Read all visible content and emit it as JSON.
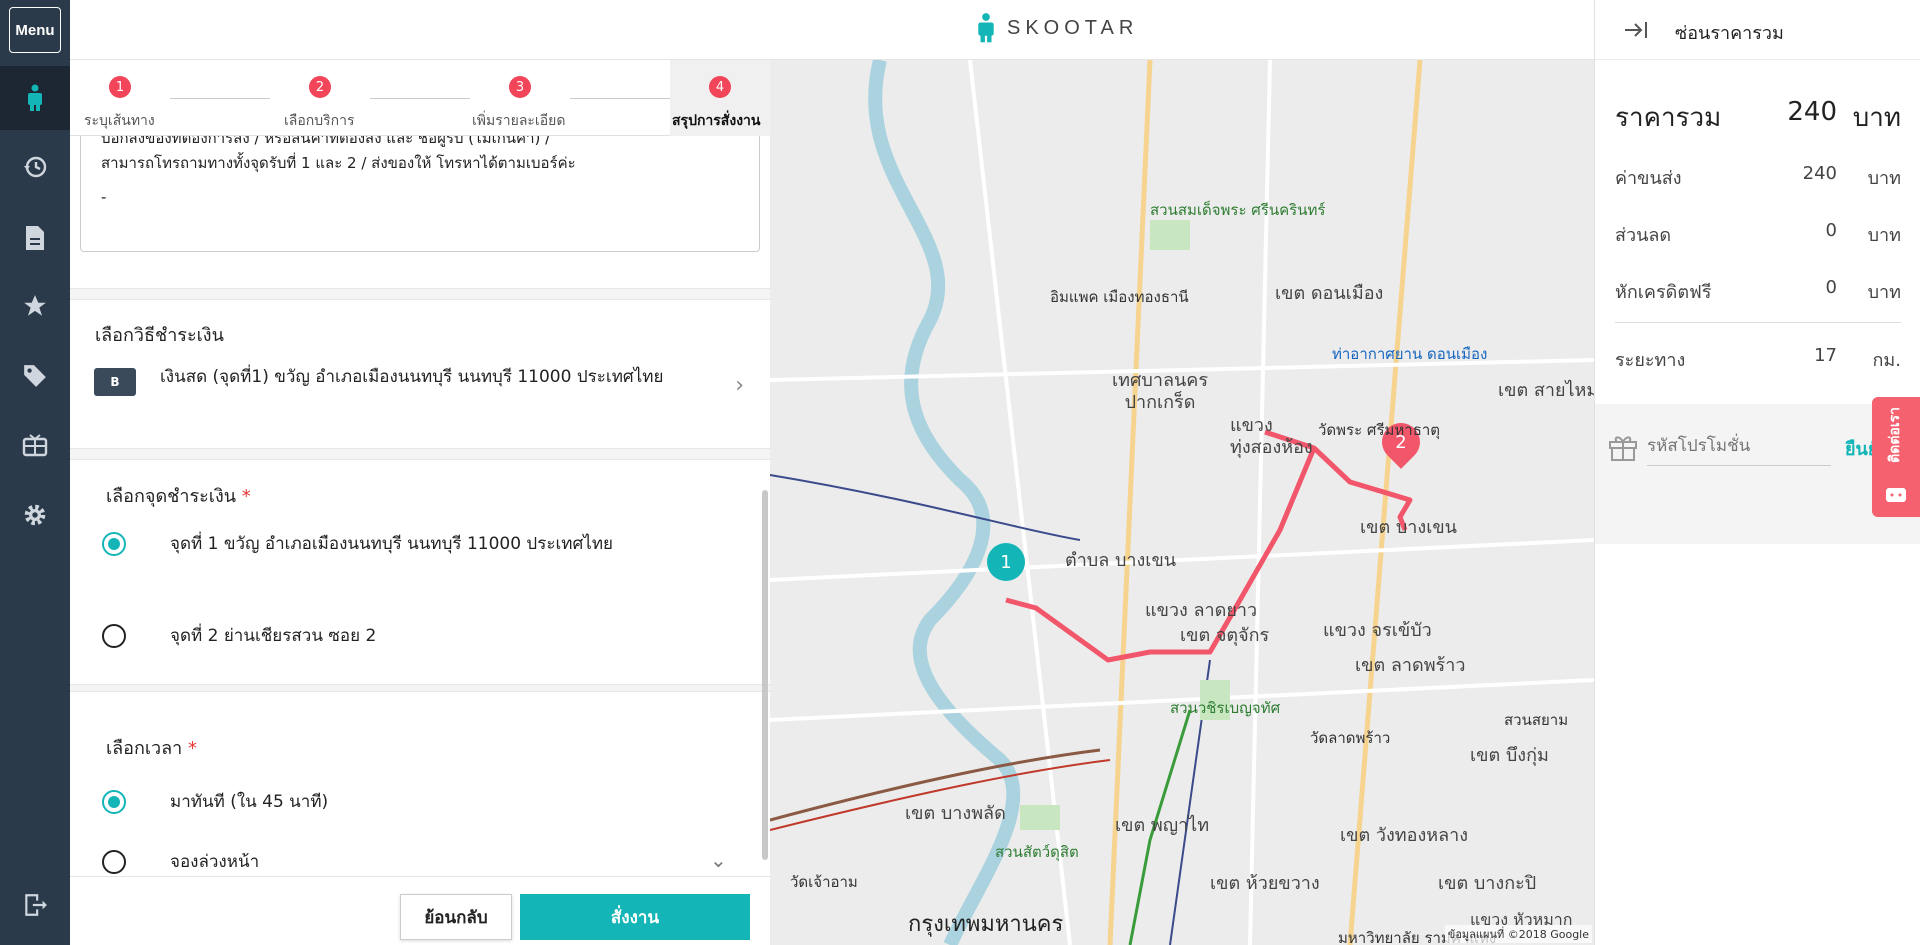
{
  "app": {
    "brand": "SKOOTAR"
  },
  "sidebar": {
    "menu_label": "Menu"
  },
  "steps": [
    {
      "num": "1",
      "label": "ระบุเส้นทาง"
    },
    {
      "num": "2",
      "label": "เลือกบริการ"
    },
    {
      "num": "3",
      "label": "เพิ่มรายละเอียด"
    },
    {
      "num": "4",
      "label": "สรุปการสั่งงาน"
    }
  ],
  "note": {
    "line1": "บอกสิ่งของที่ต้องการส่ง / หรือสินค้าที่ต้องส่ง และ ชื่อผู้รับ (ไม่เกินคำ) /",
    "line2": "สามารถโทรถามทางทั้งจุดรับที่ 1 และ 2 / ส่งของให้ โทรหาได้ตามเบอร์ค่ะ",
    "line3": "-"
  },
  "payment_method": {
    "title": "เลือกวิธีชำระเงิน",
    "icon_text": "B",
    "text": "เงินสด (จุดที่1) ขวัญ อำเภอเมืองนนทบุรี นนทบุรี 11000 ประเทศไทย"
  },
  "payment_point": {
    "title": "เลือกจุดชำระเงิน",
    "required_mark": "*",
    "options": [
      {
        "label": "จุดที่ 1 ขวัญ อำเภอเมืองนนทบุรี นนทบุรี 11000 ประเทศไทย",
        "selected": true
      },
      {
        "label": "จุดที่ 2 ย่านเชียรสวน ซอย 2",
        "selected": false
      }
    ]
  },
  "time": {
    "title": "เลือกเวลา",
    "required_mark": "*",
    "options": [
      {
        "label": "มาทันที (ใน 45 นาที)",
        "selected": true
      },
      {
        "label": "จองล่วงหน้า",
        "selected": false
      }
    ]
  },
  "footer": {
    "back_label": "ย้อนกลับ",
    "order_label": "สั่งงาน"
  },
  "map": {
    "labels": [
      "เขต ดอนเมือง",
      "เทศบาลนคร ปากเกร็ด",
      "แขวง ทุ่งสองห้อง",
      "เขต บางเขน",
      "ตำบล บางเขน",
      "แขวง ลาดยาว",
      "เขต จตุจักร",
      "แขวง จรเข้บัว",
      "เขต ลาดพร้าว",
      "เขต บางพลัด",
      "เขต พญาไท",
      "เขต วังทองหลาง",
      "เขต ห้วยขวาง",
      "เขต บางกะปิ",
      "กรุงเทพมหานคร",
      "เขต บึงกุ่ม",
      "เขต สายไหม",
      "แขวง หัวหมาก"
    ],
    "pois": [
      "สวนสมเด็จพระ ศรีนครินทร์",
      "อิมแพค เมืองทองธานี",
      "ท่าอากาศยาน ดอนเมือง",
      "วัดพระ ศรีมหาธาตุ",
      "สวนวชิรเบญจทัศ",
      "สวนสัตว์ดุสิต",
      "วัดลาดพร้าว",
      "วัดเจ้าอาม",
      "มหาวิทยาลัย รามคำแหง",
      "สวนสยาม"
    ],
    "markers": [
      "1",
      "2"
    ],
    "copyright": "ข้อมูลแผนที่ ©2018 Google",
    "route_color": "#f2566a"
  },
  "summary": {
    "header_label": "ซ่อนราคารวม",
    "total_label": "ราคารวม",
    "total_amount": "240",
    "currency": "บาท",
    "rows": [
      {
        "label": "ค่าขนส่ง",
        "amount": "240",
        "unit": "บาท"
      },
      {
        "label": "ส่วนลด",
        "amount": "0",
        "unit": "บาท"
      },
      {
        "label": "หักเครดิตฟรี",
        "amount": "0",
        "unit": "บาท"
      }
    ],
    "distance_label": "ระยะทาง",
    "distance_amount": "17",
    "distance_unit": "กม.",
    "promo_placeholder": "รหัสโปรโมชั่น",
    "promo_confirm": "ยืนยัน"
  },
  "chat_tab": {
    "label": "ติดต่อเรา"
  },
  "colors": {
    "accent": "#13b5b7",
    "sidebar": "#2b3a4a",
    "step_badge": "#f2455a"
  }
}
